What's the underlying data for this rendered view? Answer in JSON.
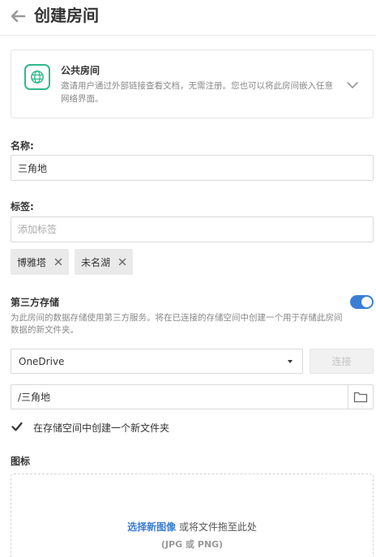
{
  "header": {
    "title": "创建房间"
  },
  "room_type": {
    "title": "公共房间",
    "description": "邀请用户通过外部链接查看文档，无需注册。您也可以将此房间嵌入任意网络界面。"
  },
  "name_field": {
    "label": "名称:",
    "value": "三角地"
  },
  "tags_field": {
    "label": "标签:",
    "placeholder": "添加标签",
    "tags": [
      "博雅塔",
      "未名湖"
    ]
  },
  "storage": {
    "title": "第三方存储",
    "description": "为此房间的数据存储使用第三方服务。将在已连接的存储空间中创建一个用于存储此房间数据的新文件夹。",
    "enabled": true,
    "provider": "OneDrive",
    "connect_label": "连接",
    "path": "/三角地",
    "create_folder_label": "在存储空间中创建一个新文件夹",
    "create_folder_checked": true
  },
  "icon_section": {
    "label": "图标",
    "select_link": "选择新图像",
    "drop_text": " 或将文件拖至此处",
    "formats": "(JPG 或 PNG)"
  },
  "colors": {
    "accent": "#3b7ed5",
    "public_green": "#2fb98a"
  }
}
